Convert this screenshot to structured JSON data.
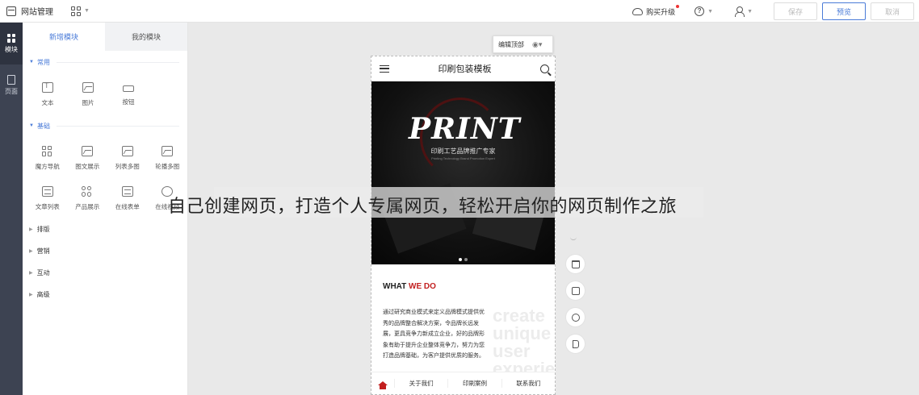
{
  "topbar": {
    "site_label": "网站管理",
    "upgrade_label": "购买升级",
    "help_glyph": "?",
    "buttons": {
      "save": "保存",
      "preview": "预览",
      "cancel": "取消"
    },
    "icons": [
      "site-icon",
      "apps-grid-icon",
      "cloud-upgrade-icon",
      "help-icon",
      "user-icon"
    ]
  },
  "rail": {
    "items": [
      {
        "label": "模块",
        "active": true,
        "icon": "modules-icon"
      },
      {
        "label": "页面",
        "active": false,
        "icon": "page-icon"
      }
    ]
  },
  "panel": {
    "tabs": [
      {
        "label": "新增模块",
        "active": true
      },
      {
        "label": "我的模块",
        "active": false
      }
    ],
    "sections": [
      {
        "title": "常用",
        "modules": [
          {
            "label": "文本",
            "icon": "text-icon"
          },
          {
            "label": "图片",
            "icon": "image-icon"
          },
          {
            "label": "按钮",
            "icon": "button-icon"
          }
        ]
      },
      {
        "title": "基础",
        "modules": [
          {
            "label": "魔方导航",
            "icon": "cube-nav-icon"
          },
          {
            "label": "图文展示",
            "icon": "image-text-icon"
          },
          {
            "label": "列表多图",
            "icon": "list-images-icon"
          },
          {
            "label": "轮播多图",
            "icon": "carousel-icon"
          },
          {
            "label": "文章列表",
            "icon": "article-list-icon"
          },
          {
            "label": "产品展示",
            "icon": "product-grid-icon"
          },
          {
            "label": "在线表单",
            "icon": "form-icon"
          },
          {
            "label": "在线视频",
            "icon": "video-icon"
          }
        ]
      }
    ],
    "categories": [
      "排版",
      "营销",
      "互动",
      "高级"
    ]
  },
  "canvas": {
    "edit_header_label": "编辑顶部",
    "phone": {
      "title": "印刷包装模板",
      "banner": {
        "logo": "PRINT",
        "subtitle": "印刷工艺品牌推广专家",
        "subtitle_en": "Printing Technology Brand Promotion Expert"
      },
      "section_title_a": "WHAT ",
      "section_title_b": "WE DO",
      "body_lines": [
        "通过研究商业模式来定义品牌模式提供优",
        "秀的品牌整合解决方案，令品牌长远发",
        "展，更具竞争力新成立企业，好的品牌形",
        "象有助于提升企业整体竞争力，努力为您",
        "打造品牌基础，为客户提供优质的服务。"
      ],
      "watermark": [
        "create",
        "unique user",
        "experience"
      ],
      "footer": [
        "关于我们",
        "印刷案例",
        "联系我们"
      ]
    }
  },
  "caption": "自己创建网页，打造个人专属网页，轻松开启你的网页制作之旅",
  "colors": {
    "accent": "#4a7bd8",
    "brand_red": "#c21f1f",
    "rail": "#3d4352"
  }
}
